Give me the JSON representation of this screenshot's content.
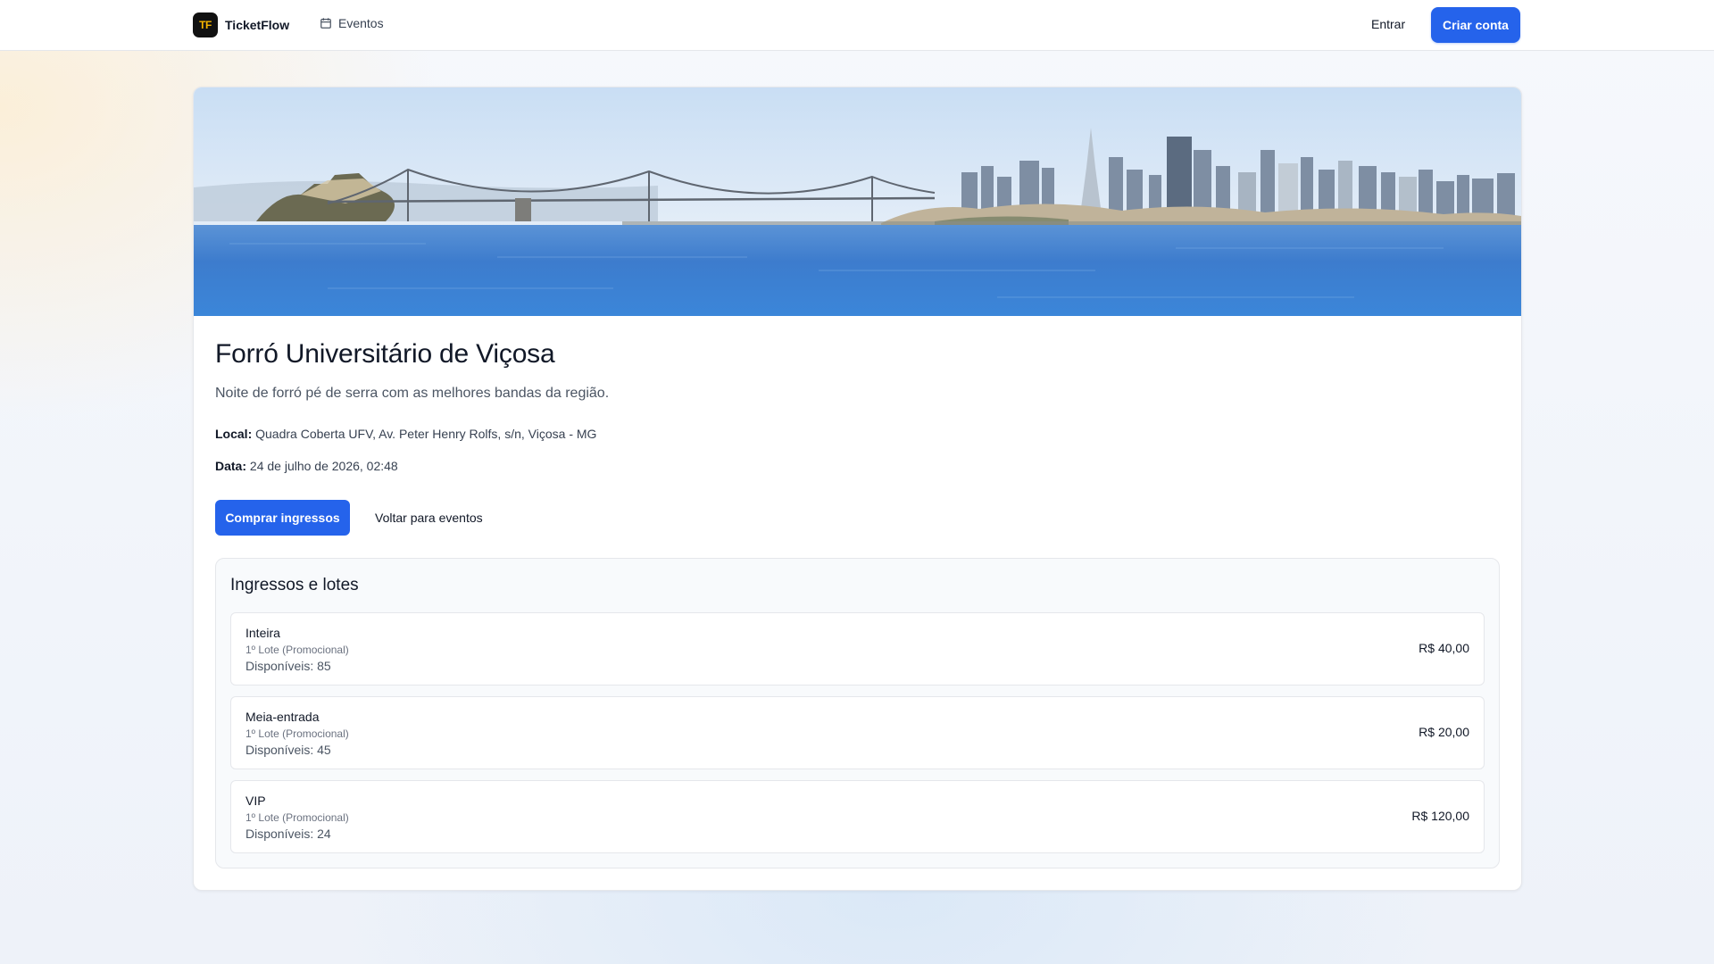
{
  "header": {
    "brand_mark": "TF",
    "brand_name": "TicketFlow",
    "nav_events": "Eventos",
    "login": "Entrar",
    "signup": "Criar conta"
  },
  "event": {
    "title": "Forró Universitário de Viçosa",
    "description": "Noite de forró pé de serra com as melhores bandas da região.",
    "local_label": "Local:",
    "local_value": "Quadra Coberta UFV, Av. Peter Henry Rolfs, s/n, Viçosa - MG",
    "date_label": "Data:",
    "date_value": "24 de julho de 2026, 02:48",
    "buy_label": "Comprar ingressos",
    "back_label": "Voltar para eventos"
  },
  "tickets": {
    "title": "Ingressos e lotes",
    "items": [
      {
        "name": "Inteira",
        "lot": "1º Lote (Promocional)",
        "available": "Disponíveis: 85",
        "price": "R$ 40,00"
      },
      {
        "name": "Meia-entrada",
        "lot": "1º Lote (Promocional)",
        "available": "Disponíveis: 45",
        "price": "R$ 20,00"
      },
      {
        "name": "VIP",
        "lot": "1º Lote (Promocional)",
        "available": "Disponíveis: 24",
        "price": "R$ 120,00"
      }
    ]
  },
  "icons": {
    "calendar": "calendar-icon"
  },
  "colors": {
    "accent": "#2563eb",
    "brand_mark_bg": "#111111",
    "brand_mark_text": "#f5b400"
  }
}
